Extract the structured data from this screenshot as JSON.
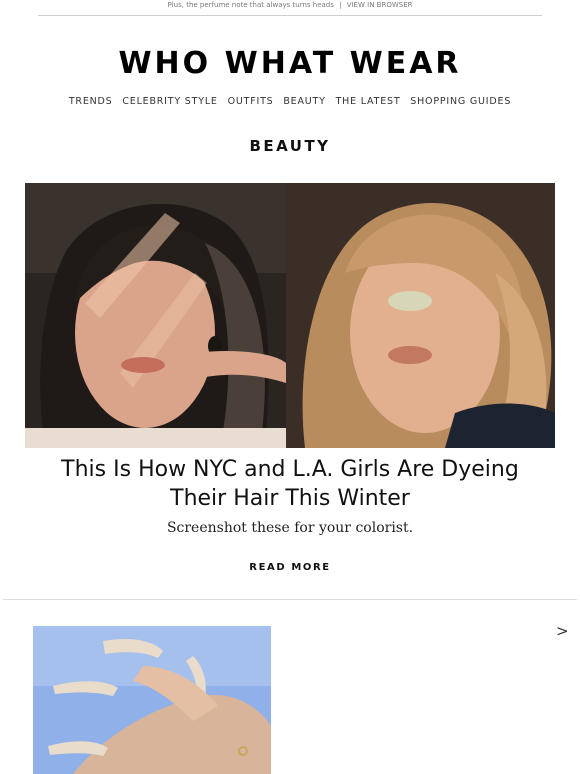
{
  "preheader": {
    "text": "Plus, the perfume note that always turns heads",
    "separator": "|",
    "view_in_browser": "VIEW IN BROWSER"
  },
  "brand": {
    "logo_text": "WHO WHAT WEAR"
  },
  "nav": {
    "items": [
      {
        "label": "TRENDS"
      },
      {
        "label": "CELEBRITY STYLE"
      },
      {
        "label": "OUTFITS"
      },
      {
        "label": "BEAUTY"
      },
      {
        "label": "THE LATEST"
      },
      {
        "label": "SHOPPING GUIDES"
      }
    ]
  },
  "section": {
    "title": "BEAUTY"
  },
  "article": {
    "headline": "This Is How NYC and L.A. Girls Are Dyeing Their Hair This Winter",
    "subhead": "Screenshot these for your colorist.",
    "cta": "READ MORE"
  },
  "next_item": {
    "arrow": ">"
  },
  "colors": {
    "text": "#111111",
    "muted": "#7a7a7a",
    "rule": "#cfcfcf",
    "thumb_sky": "#8fb0e8"
  }
}
